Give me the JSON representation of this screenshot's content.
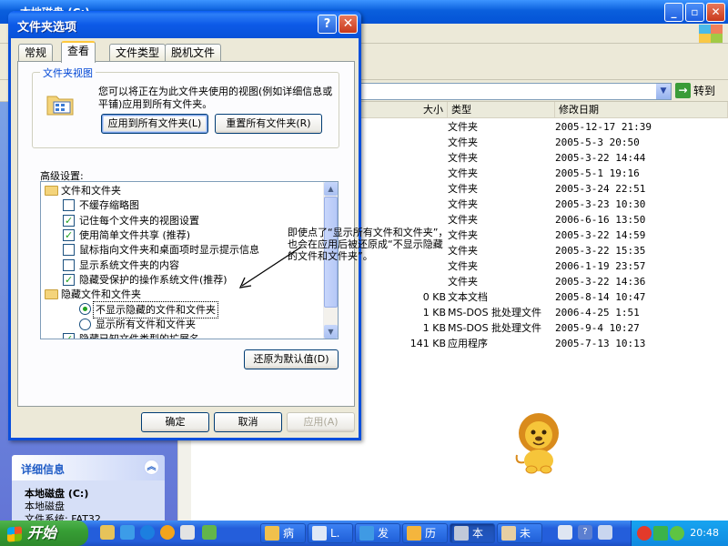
{
  "explorer": {
    "title": "本地磁盘 (C:)",
    "address_go": "转到",
    "columns": {
      "size": "大小",
      "type": "类型",
      "modified": "修改日期"
    },
    "files": [
      {
        "size": "",
        "type": "文件夹",
        "modified": "2005-12-17 21:39"
      },
      {
        "size": "",
        "type": "文件夹",
        "modified": "2005-5-3 20:50"
      },
      {
        "size": "",
        "type": "文件夹",
        "modified": "2005-3-22 14:44"
      },
      {
        "size": "",
        "type": "文件夹",
        "modified": "2005-5-1 19:16"
      },
      {
        "size": "",
        "type": "文件夹",
        "modified": "2005-3-24 22:51"
      },
      {
        "size": "",
        "type": "文件夹",
        "modified": "2005-3-23 10:30"
      },
      {
        "size": "",
        "type": "文件夹",
        "modified": "2006-6-16 13:50"
      },
      {
        "size": "",
        "type": "文件夹",
        "modified": "2005-3-22 14:59"
      },
      {
        "size": "",
        "type": "文件夹",
        "modified": "2005-3-22 15:35"
      },
      {
        "size": "",
        "type": "文件夹",
        "modified": "2006-1-19 23:57"
      },
      {
        "size": "",
        "type": "文件夹",
        "modified": "2005-3-22 14:36"
      },
      {
        "size": "0 KB",
        "type": "文本文档",
        "modified": "2005-8-14 10:47"
      },
      {
        "size": "1 KB",
        "type": "MS-DOS 批处理文件",
        "modified": "2006-4-25 1:51"
      },
      {
        "size": "1 KB",
        "type": "MS-DOS 批处理文件",
        "modified": "2005-9-4 10:27"
      },
      {
        "size": "141 KB",
        "type": "应用程序",
        "modified": "2005-7-13 10:13"
      }
    ],
    "details": {
      "header": "详细信息",
      "name": "本地磁盘 (C:)",
      "kind": "本地磁盘",
      "extra": "文件系统: FAT32"
    }
  },
  "dialog": {
    "title": "文件夹选项",
    "help": "?",
    "close": "✕",
    "tabs": [
      "常规",
      "查看",
      "文件类型",
      "脱机文件"
    ],
    "folder_view": {
      "legend": "文件夹视图",
      "description": "您可以将正在为此文件夹使用的视图(例如详细信息或平铺)应用到所有文件夹。",
      "apply_all": "应用到所有文件夹(L)",
      "reset_all": "重置所有文件夹(R)"
    },
    "advanced_label": "高级设置:",
    "tree": [
      {
        "kind": "folder",
        "label": "文件和文件夹"
      },
      {
        "kind": "check",
        "checked": false,
        "label": "不缓存缩略图"
      },
      {
        "kind": "check",
        "checked": true,
        "label": "记住每个文件夹的视图设置"
      },
      {
        "kind": "check",
        "checked": true,
        "label": "使用简单文件共享 (推荐)"
      },
      {
        "kind": "check",
        "checked": false,
        "label": "鼠标指向文件夹和桌面项时显示提示信息"
      },
      {
        "kind": "check",
        "checked": false,
        "label": "显示系统文件夹的内容"
      },
      {
        "kind": "check",
        "checked": true,
        "label": "隐藏受保护的操作系统文件(推荐)"
      },
      {
        "kind": "folder",
        "label": "隐藏文件和文件夹"
      },
      {
        "kind": "radio",
        "checked": true,
        "label": "不显示隐藏的文件和文件夹"
      },
      {
        "kind": "radio",
        "checked": false,
        "label": "显示所有文件和文件夹"
      },
      {
        "kind": "check",
        "checked": true,
        "label": "隐藏已知文件类型的扩展名"
      }
    ],
    "restore_defaults": "还原为默认值(D)",
    "ok": "确定",
    "cancel": "取消",
    "apply": "应用(A)"
  },
  "annotation": "即使点了“显示所有文件和文件夹”，也会在应用后被还原成“不显示隐藏的文件和文件夹”。",
  "taskbar": {
    "start": "开始",
    "tasks": [
      "病",
      "L.",
      "发",
      "历",
      "本",
      "未"
    ],
    "clock": "20:48"
  },
  "colors": {
    "xp_blue": "#0a5fdc",
    "start_green": "#379e35",
    "legend_blue": "#0046d5"
  }
}
